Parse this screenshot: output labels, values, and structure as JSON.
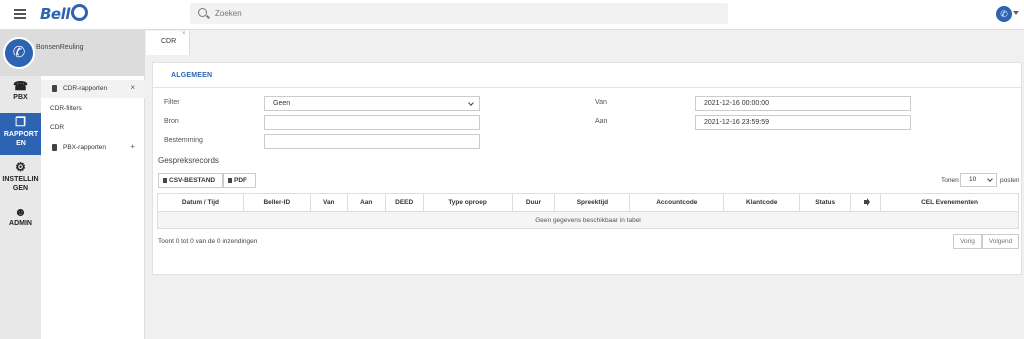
{
  "header": {
    "logo_text": "Bell",
    "search": {
      "placeholder": "Zoeken"
    }
  },
  "profile": {
    "name": "BonsenReuling"
  },
  "rail": {
    "items": [
      {
        "label": "PBX",
        "icon": "phone-icon"
      },
      {
        "label": "RAPPORTEN",
        "icon": "reports-icon",
        "active": true
      },
      {
        "label": "INSTELLINGEN",
        "icon": "gears-icon"
      },
      {
        "label": "ADMIN",
        "icon": "admin-icon"
      }
    ]
  },
  "submenu": {
    "items": [
      {
        "label": "CDR-rapporten",
        "control": "×"
      },
      {
        "label": "CDR-filters"
      },
      {
        "label": "CDR"
      },
      {
        "label": "PBX-rapporten",
        "control": "+"
      }
    ]
  },
  "tabs": [
    {
      "label": "CDR",
      "close": "×"
    }
  ],
  "panel": {
    "heading": "ALGEMEEN",
    "form": {
      "filter_label": "Filter",
      "filter_value": "Geen",
      "bron_label": "Bron",
      "bron_value": "",
      "bestemming_label": "Bestemming",
      "bestemming_value": "",
      "van_label": "Van",
      "van_value": "2021-12-16 00:00:00",
      "aan_label": "Aan",
      "aan_value": "2021-12-16 23:59:59"
    },
    "records_title": "Gespreksrecords",
    "buttons": {
      "csv": "CSV-BESTAND",
      "pdf": "PDF"
    },
    "show": {
      "prefix": "Tonen",
      "value": "10",
      "suffix": "posten"
    },
    "table": {
      "columns": [
        "Datum / Tijd",
        "Beller-ID",
        "Van",
        "Aan",
        "DEED",
        "Type oproep",
        "Duur",
        "Spreektijd",
        "Accountcode",
        "Klantcode",
        "Status",
        "",
        "CEL Evenementen"
      ],
      "empty_text": "Geen gegevens beschikbaar in tabel"
    },
    "info": "Toont 0 tot 0 van de 0 inzendingen",
    "pagination": {
      "prev": "Vorig",
      "next": "Volgend"
    }
  }
}
